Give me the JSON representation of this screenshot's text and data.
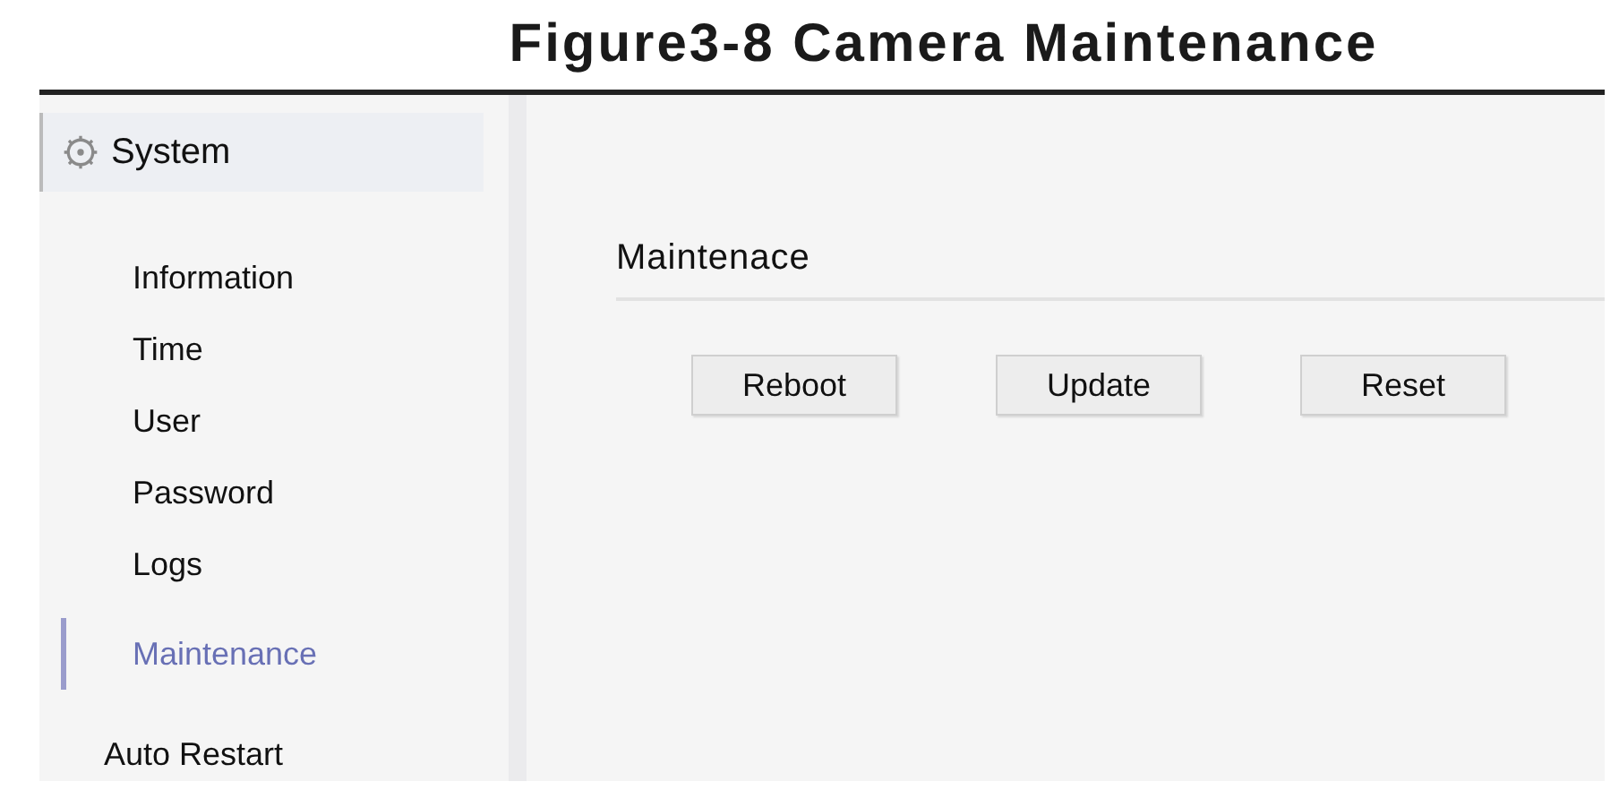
{
  "caption": "Figure3-8 Camera Maintenance",
  "sidebar": {
    "header": "System",
    "items": [
      {
        "label": "Information",
        "selected": false
      },
      {
        "label": "Time",
        "selected": false
      },
      {
        "label": "User",
        "selected": false
      },
      {
        "label": "Password",
        "selected": false
      },
      {
        "label": "Logs",
        "selected": false
      },
      {
        "label": "Maintenance",
        "selected": true
      },
      {
        "label": "Auto Restart",
        "selected": false
      }
    ]
  },
  "section": {
    "title": "Maintenace",
    "buttons": [
      "Reboot",
      "Update",
      "Reset"
    ]
  }
}
